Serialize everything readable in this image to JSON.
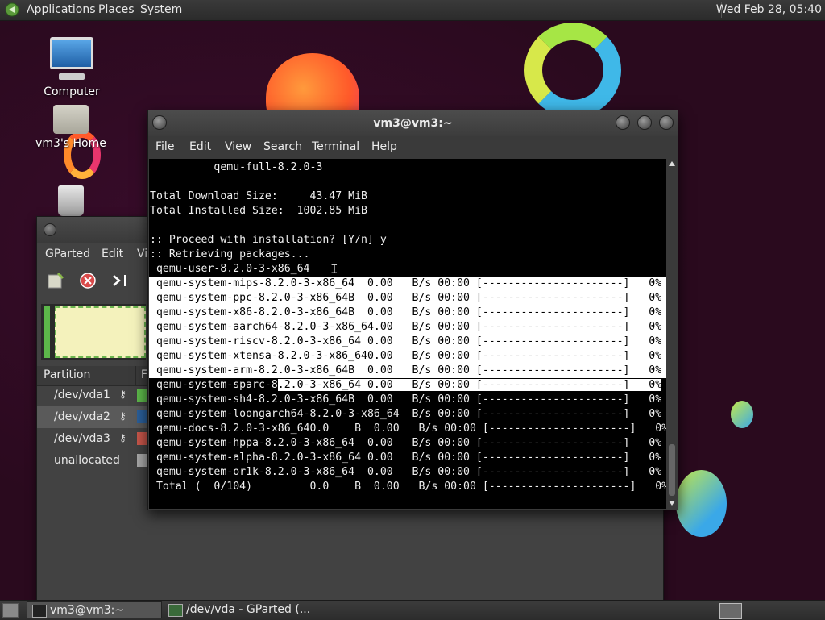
{
  "top_panel": {
    "menus": [
      "Applications",
      "Places",
      "System"
    ],
    "clock": "Wed Feb 28, 05:40"
  },
  "desktop_icons": [
    {
      "label": "Computer",
      "icon": "computer-icon"
    },
    {
      "label": "vm3's Home",
      "icon": "home-folder-icon"
    },
    {
      "label": "",
      "icon": "trash-icon"
    }
  ],
  "terminal": {
    "title": "vm3@vm3:~",
    "menus": [
      "File",
      "Edit",
      "View",
      "Search",
      "Terminal",
      "Help"
    ],
    "lines_top": [
      "          qemu-full-8.2.0-3",
      "",
      "Total Download Size:     43.47 MiB",
      "Total Installed Size:  1002.85 MiB",
      "",
      ":: Proceed with installation? [Y/n] y",
      ":: Retrieving packages...",
      " qemu-user-8.2.0-3-x86_64"
    ],
    "lines_highlighted": [
      " qemu-system-mips-8.2.0-3-x86_64  0.00   B/s 00:00 [----------------------]   0%",
      " qemu-system-ppc-8.2.0-3-x86_64B  0.00   B/s 00:00 [----------------------]   0%",
      " qemu-system-x86-8.2.0-3-x86_64B  0.00   B/s 00:00 [----------------------]   0%",
      " qemu-system-aarch64-8.2.0-3-x86_64.00   B/s 00:00 [----------------------]   0%",
      " qemu-system-riscv-8.2.0-3-x86_64 0.00   B/s 00:00 [----------------------]   0%",
      " qemu-system-xtensa-8.2.0-3-x86_640.00   B/s 00:00 [----------------------]   0%",
      " qemu-system-arm-8.2.0-3-x86_64B  0.00   B/s 00:00 [----------------------]   0%"
    ],
    "line_partial_left": " qemu-system-sparc-8",
    "line_partial_right": ".2.0-3-x86_64 0.00   B/s 00:00 [----------------------]   0%",
    "lines_bottom": [
      " qemu-system-sh4-8.2.0-3-x86_64B  0.00   B/s 00:00 [----------------------]   0%",
      " qemu-system-loongarch64-8.2.0-3-x86_64  B/s 00:00 [----------------------]   0%",
      " qemu-docs-8.2.0-3-x86_640.0    B  0.00   B/s 00:00 [----------------------]   0%",
      " qemu-system-hppa-8.2.0-3-x86_64  0.00   B/s 00:00 [----------------------]   0%",
      " qemu-system-alpha-8.2.0-3-x86_64 0.00   B/s 00:00 [----------------------]   0%",
      " qemu-system-or1k-8.2.0-3-x86_64  0.00   B/s 00:00 [----------------------]   0%",
      " Total (  0/104)         0.0    B  0.00   B/s 00:00 [----------------------]   0%"
    ]
  },
  "gparted": {
    "menus": [
      "GParted",
      "Edit",
      "Vi"
    ],
    "partition_header": "Partition",
    "fs_header": "F",
    "partitions": [
      {
        "name": "/dev/vda1",
        "key": true,
        "color": "#5cb84a"
      },
      {
        "name": "/dev/vda2",
        "key": true,
        "color": "#2a5f9a"
      },
      {
        "name": "/dev/vda3",
        "key": true,
        "color": "#c8564a"
      },
      {
        "name": "unallocated",
        "key": false,
        "color": "#a8a8a8"
      }
    ]
  },
  "taskbar": {
    "tasks": [
      {
        "label": "vm3@vm3:~",
        "active": true
      },
      {
        "label": "/dev/vda - GParted (...",
        "active": false
      }
    ]
  }
}
